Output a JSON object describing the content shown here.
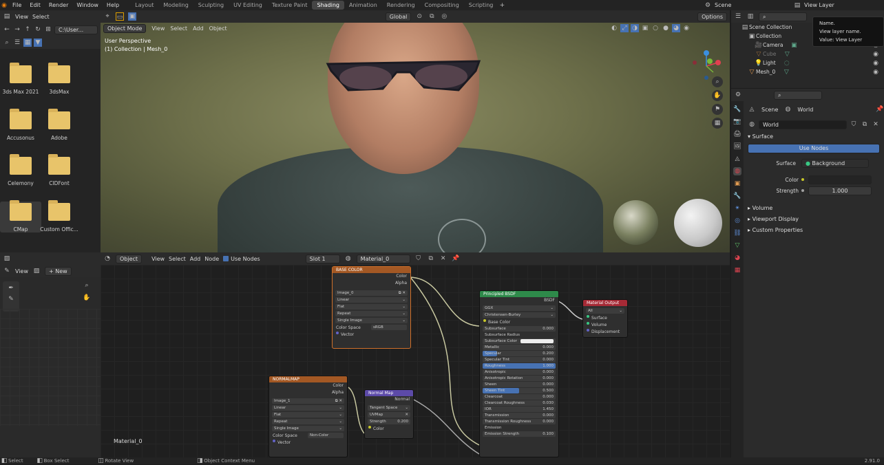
{
  "topbar": {
    "menus": [
      "File",
      "Edit",
      "Render",
      "Window",
      "Help"
    ],
    "workspaces": [
      "Layout",
      "Modeling",
      "Sculpting",
      "UV Editing",
      "Texture Paint",
      "Shading",
      "Animation",
      "Rendering",
      "Compositing",
      "Scripting"
    ],
    "active_workspace": "Shading",
    "scene": "Scene",
    "view_layer": "View Layer"
  },
  "tooltip": {
    "line1": "Name.",
    "line2": "View layer name.",
    "line3": "Value: View Layer"
  },
  "file_browser": {
    "view": "View",
    "select": "Select",
    "path": "C:\\User...",
    "folders": [
      "3ds Max 2021",
      "3dsMax",
      "Accusonus",
      "Adobe",
      "Celemony",
      "CIDFont",
      "CMap",
      "Custom Offic..."
    ]
  },
  "viewport": {
    "header": {
      "mode": "Object Mode",
      "view": "View",
      "select": "Select",
      "add": "Add",
      "object": "Object",
      "transform": "Global",
      "options": "Options"
    },
    "perspective": "User Perspective",
    "collection_info": "(1) Collection | Mesh_0"
  },
  "node_editor": {
    "header": {
      "type": "Object",
      "view": "View",
      "select": "Select",
      "add": "Add",
      "node": "Node",
      "use_nodes": "Use Nodes",
      "slot": "Slot 1",
      "material": "Material_0"
    },
    "material_label": "Material_0",
    "base_color_node": {
      "title": "BASE COLOR",
      "out_color": "Color",
      "out_alpha": "Alpha",
      "image": "Image_0",
      "interp": "Linear",
      "proj": "Flat",
      "ext": "Repeat",
      "source": "Single Image",
      "cs_label": "Color Space",
      "cs_value": "sRGB",
      "vector": "Vector"
    },
    "normal_map_tex": {
      "title": "NORMALMAP",
      "out_color": "Color",
      "out_alpha": "Alpha",
      "image": "Image_1",
      "interp": "Linear",
      "proj": "Flat",
      "ext": "Repeat",
      "source": "Single Image",
      "cs_label": "Color Space",
      "cs_value": "Non-Color",
      "vector": "Vector"
    },
    "normal_map_node": {
      "title": "Normal Map",
      "out": "Normal",
      "space": "Tangent Space",
      "uv": "UVMap",
      "strength_label": "Strength",
      "strength": "0.200",
      "color": "Color"
    },
    "bsdf": {
      "title": "Principled BSDF",
      "out": "BSDF",
      "dist": "GGX",
      "sss_method": "Christensen-Burley",
      "base_color": "Base Color",
      "rows": [
        {
          "label": "Subsurface",
          "value": "0.000"
        },
        {
          "label": "Subsurface Radius",
          "value": ""
        },
        {
          "label": "Subsurface Color",
          "value": ""
        },
        {
          "label": "Metallic",
          "value": "0.000"
        },
        {
          "label": "Specular",
          "value": "0.200"
        },
        {
          "label": "Specular Tint",
          "value": "0.000"
        },
        {
          "label": "Roughness",
          "value": "1.000"
        },
        {
          "label": "Anisotropic",
          "value": "0.000"
        },
        {
          "label": "Anisotropic Rotation",
          "value": "0.000"
        },
        {
          "label": "Sheen",
          "value": "0.000"
        },
        {
          "label": "Sheen Tint",
          "value": "0.500"
        },
        {
          "label": "Clearcoat",
          "value": "0.000"
        },
        {
          "label": "Clearcoat Roughness",
          "value": "0.030"
        },
        {
          "label": "IOR",
          "value": "1.450"
        },
        {
          "label": "Transmission",
          "value": "0.000"
        },
        {
          "label": "Transmission Roughness",
          "value": "0.000"
        },
        {
          "label": "Emission",
          "value": ""
        },
        {
          "label": "Emission Strength",
          "value": "0.100"
        }
      ]
    },
    "output": {
      "title": "Material Output",
      "target": "All",
      "surface": "Surface",
      "volume": "Volume",
      "displacement": "Displacement"
    }
  },
  "tool_panel": {
    "view": "View",
    "new": "New"
  },
  "outliner": {
    "items": [
      {
        "label": "Scene Collection"
      },
      {
        "label": "Collection"
      },
      {
        "label": "Camera"
      },
      {
        "label": "Cube"
      },
      {
        "label": "Light"
      },
      {
        "label": "Mesh_0"
      }
    ]
  },
  "properties": {
    "tab_scene": "Scene",
    "tab_world": "World",
    "world_name": "World",
    "surface_section": "Surface",
    "use_nodes": "Use Nodes",
    "surface_label": "Surface",
    "surface_value": "Background",
    "color_label": "Color",
    "strength_label": "Strength",
    "strength_value": "1.000",
    "volume": "Volume",
    "viewport_display": "Viewport Display",
    "custom_properties": "Custom Properties"
  },
  "statusbar": {
    "select": "Select",
    "box_select": "Box Select",
    "rotate_view": "Rotate View",
    "context_menu": "Object Context Menu",
    "version": "2.91.0"
  }
}
